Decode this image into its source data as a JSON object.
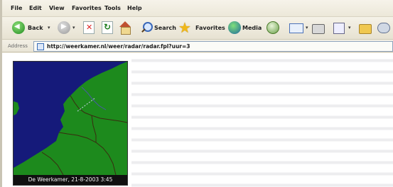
{
  "menubar": {
    "items": [
      "File",
      "Edit",
      "View",
      "Favorites",
      "Tools",
      "Help"
    ]
  },
  "toolbar": {
    "back_label": "Back",
    "search_label": "Search",
    "favorites_label": "Favorites",
    "media_label": "Media",
    "dropdown_glyph": "▾"
  },
  "address": {
    "label": "Address",
    "url": "http://weerkamer.nl/weer/radar/radar.fpl?uur=3"
  },
  "radar": {
    "caption": "De Weerkamer, 21-8-2003 3:45",
    "colors": {
      "sea": "#151a7a",
      "land": "#1d8a1d",
      "borders": "#3a2a10"
    }
  }
}
